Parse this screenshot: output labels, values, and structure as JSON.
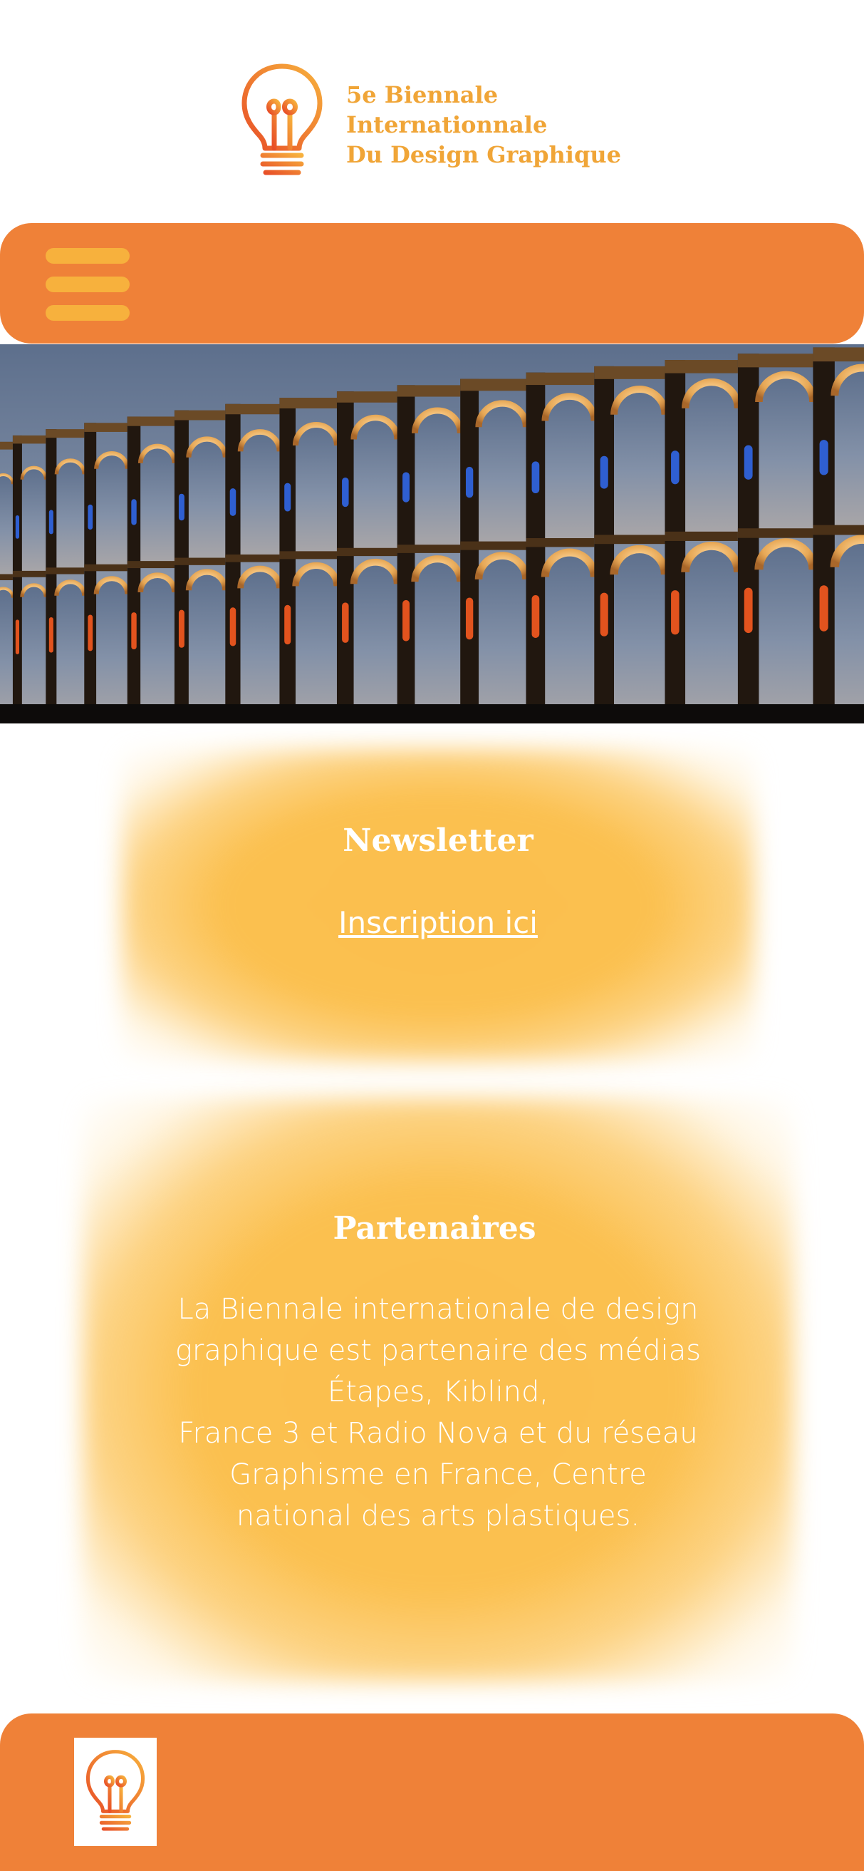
{
  "header": {
    "logo_icon": "lightbulb-icon",
    "title_lines": [
      "5e Biennale",
      "Internationnale",
      "Du Design Graphique"
    ]
  },
  "nav": {
    "menu_icon": "hamburger-menu-icon"
  },
  "hero": {
    "image": "illuminated-aqueduct-at-dusk"
  },
  "newsletter": {
    "title": "Newsletter",
    "link_label": "Inscription ici"
  },
  "partners": {
    "title": "Partenaires",
    "body_lines": [
      "La Biennale internationale de design",
      "graphique est partenaire des médias",
      "Étapes, Kiblind,",
      "France 3 et Radio Nova et du réseau",
      "Graphisme en France, Centre",
      "national des arts plastiques."
    ]
  },
  "footer": {
    "logo_icon": "lightbulb-icon"
  },
  "colors": {
    "brand_orange": "#ef8138",
    "accent_yellow": "#f7b13d",
    "glow_yellow": "#fbbf4e",
    "logo_text": "#f0a537"
  }
}
